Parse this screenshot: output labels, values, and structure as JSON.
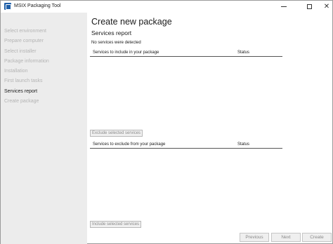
{
  "window": {
    "title": "MSIX Packaging Tool"
  },
  "sidebar": {
    "items": [
      {
        "label": "Select environment",
        "active": false
      },
      {
        "label": "Prepare computer",
        "active": false
      },
      {
        "label": "Select installer",
        "active": false
      },
      {
        "label": "Package information",
        "active": false
      },
      {
        "label": "Installation",
        "active": false
      },
      {
        "label": "First launch tasks",
        "active": false
      },
      {
        "label": "Services report",
        "active": true
      },
      {
        "label": "Create package",
        "active": false
      }
    ]
  },
  "main": {
    "title": "Create new package",
    "section_title": "Services report",
    "info": "No services were detected",
    "include_table": {
      "col_name": "Services to include in your package",
      "col_status": "Status",
      "button": "Exclude selected services"
    },
    "exclude_table": {
      "col_name": "Services to exclude from your package",
      "col_status": "Status",
      "button": "Include selected services"
    }
  },
  "footer": {
    "previous": "Previous",
    "next": "Next",
    "create": "Create"
  }
}
